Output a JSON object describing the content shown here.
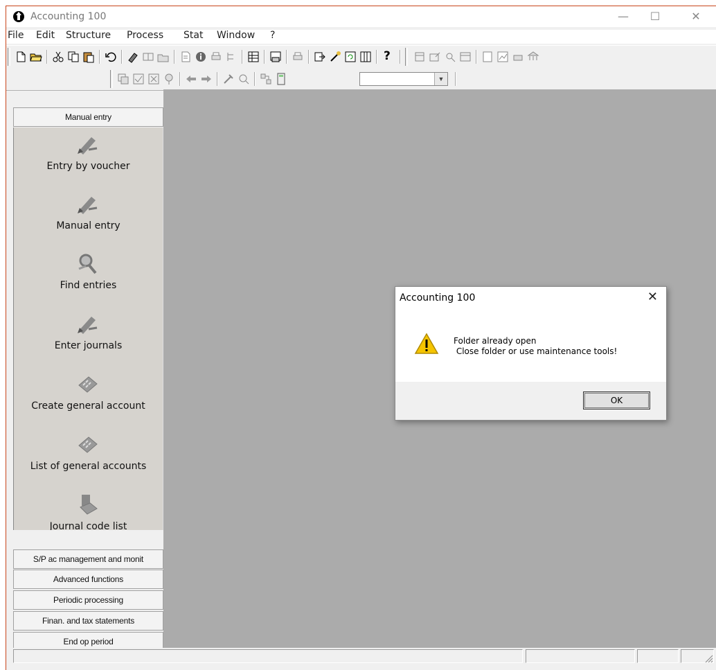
{
  "window": {
    "title": "Accounting 100",
    "minimize": "—",
    "maximize": "☐",
    "close": "✕"
  },
  "menu": {
    "items": [
      "File",
      "Edit",
      "Structure",
      "Process",
      "Stat",
      "Window",
      "?"
    ]
  },
  "toolbar": {
    "help_label": "?"
  },
  "sidebar": {
    "active_section": "Manual entry",
    "items": [
      {
        "label": "Entry by voucher",
        "icon": "pen-hand-icon"
      },
      {
        "label": "Manual entry",
        "icon": "pen-hand-icon"
      },
      {
        "label": "Find entries",
        "icon": "magnifier-icon"
      },
      {
        "label": "Enter journals",
        "icon": "pen-hand-icon"
      },
      {
        "label": "Create general account",
        "icon": "calculator-icon"
      },
      {
        "label": "List of general accounts",
        "icon": "calculator-icon"
      },
      {
        "label": "Journal code list",
        "icon": "journal-icon"
      }
    ],
    "sections": [
      "S/P ac management and monit",
      "Advanced functions",
      "Periodic processing",
      "Finan. and tax statements",
      "End op period"
    ],
    "scroll_down": "▼"
  },
  "dialog": {
    "title": "Accounting 100",
    "close": "✕",
    "message_line1": "Folder already open",
    "message_line2": " Close folder or use maintenance tools!",
    "ok_label": "OK",
    "icon": "warning-icon"
  },
  "colors": {
    "mdi_background": "#ababab",
    "sidebar_panel": "#d6d3ce",
    "warning": "#f5c400",
    "window_border": "#c8441a"
  }
}
